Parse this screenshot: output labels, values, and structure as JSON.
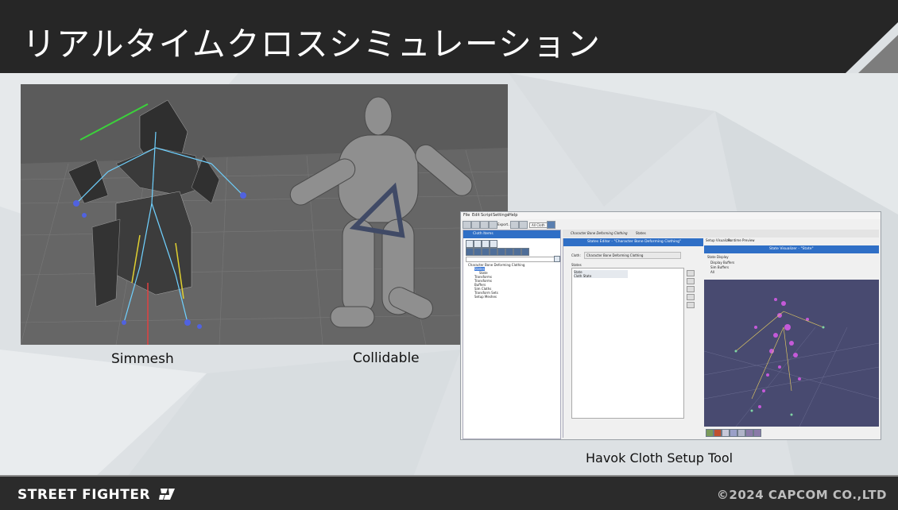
{
  "slide": {
    "title": "リアルタイムクロスシミュレーション",
    "brand": "STREET FIGHTER",
    "copyright": "©2024 CAPCOM CO.,LTD",
    "colors": {
      "title_bg": "#262626",
      "footer_bg": "#2b2b2b",
      "accent": "#2f6fc6"
    }
  },
  "captions": {
    "simmesh": "Simmesh",
    "collidable": "Collidable",
    "havok": "Havok Cloth Setup Tool"
  },
  "havok_tool": {
    "menu": [
      "File",
      "Edit",
      "Script",
      "Settings",
      "Help"
    ],
    "toolbar": {
      "export_label": "Export...",
      "cloth_dropdown": "All Cloth"
    },
    "top_tabs": [
      "Character Bone Deforming Clothing",
      "States"
    ],
    "cloth_items_header": "Cloth Items",
    "tree": [
      "Character Bone Deforming Clothing",
      "States",
      "State",
      "Transforms",
      "Transforms",
      "Buffers",
      "Sim Cloths",
      "Transform Sets",
      "Setup Meshes"
    ],
    "states_editor": {
      "header": "States Editor - \"Character Bone Deforming Clothing\"",
      "cloth_label": "Cloth:",
      "cloth_value": "Character Bone Deforming Clothing",
      "states_label": "States",
      "states": [
        "State",
        "Cloth State"
      ]
    },
    "visualizer": {
      "tabs": [
        "Setup Visualizer",
        "Runtime Preview"
      ],
      "header": "State Visualizer - \"State\"",
      "display_label": "State Display",
      "options": [
        "Display Buffers",
        "Sim Buffers",
        "All"
      ],
      "selected_option": "All"
    },
    "icons": [
      "save-icon",
      "open-icon",
      "new-icon",
      "export-icon",
      "refresh-icon",
      "run-icon"
    ]
  }
}
